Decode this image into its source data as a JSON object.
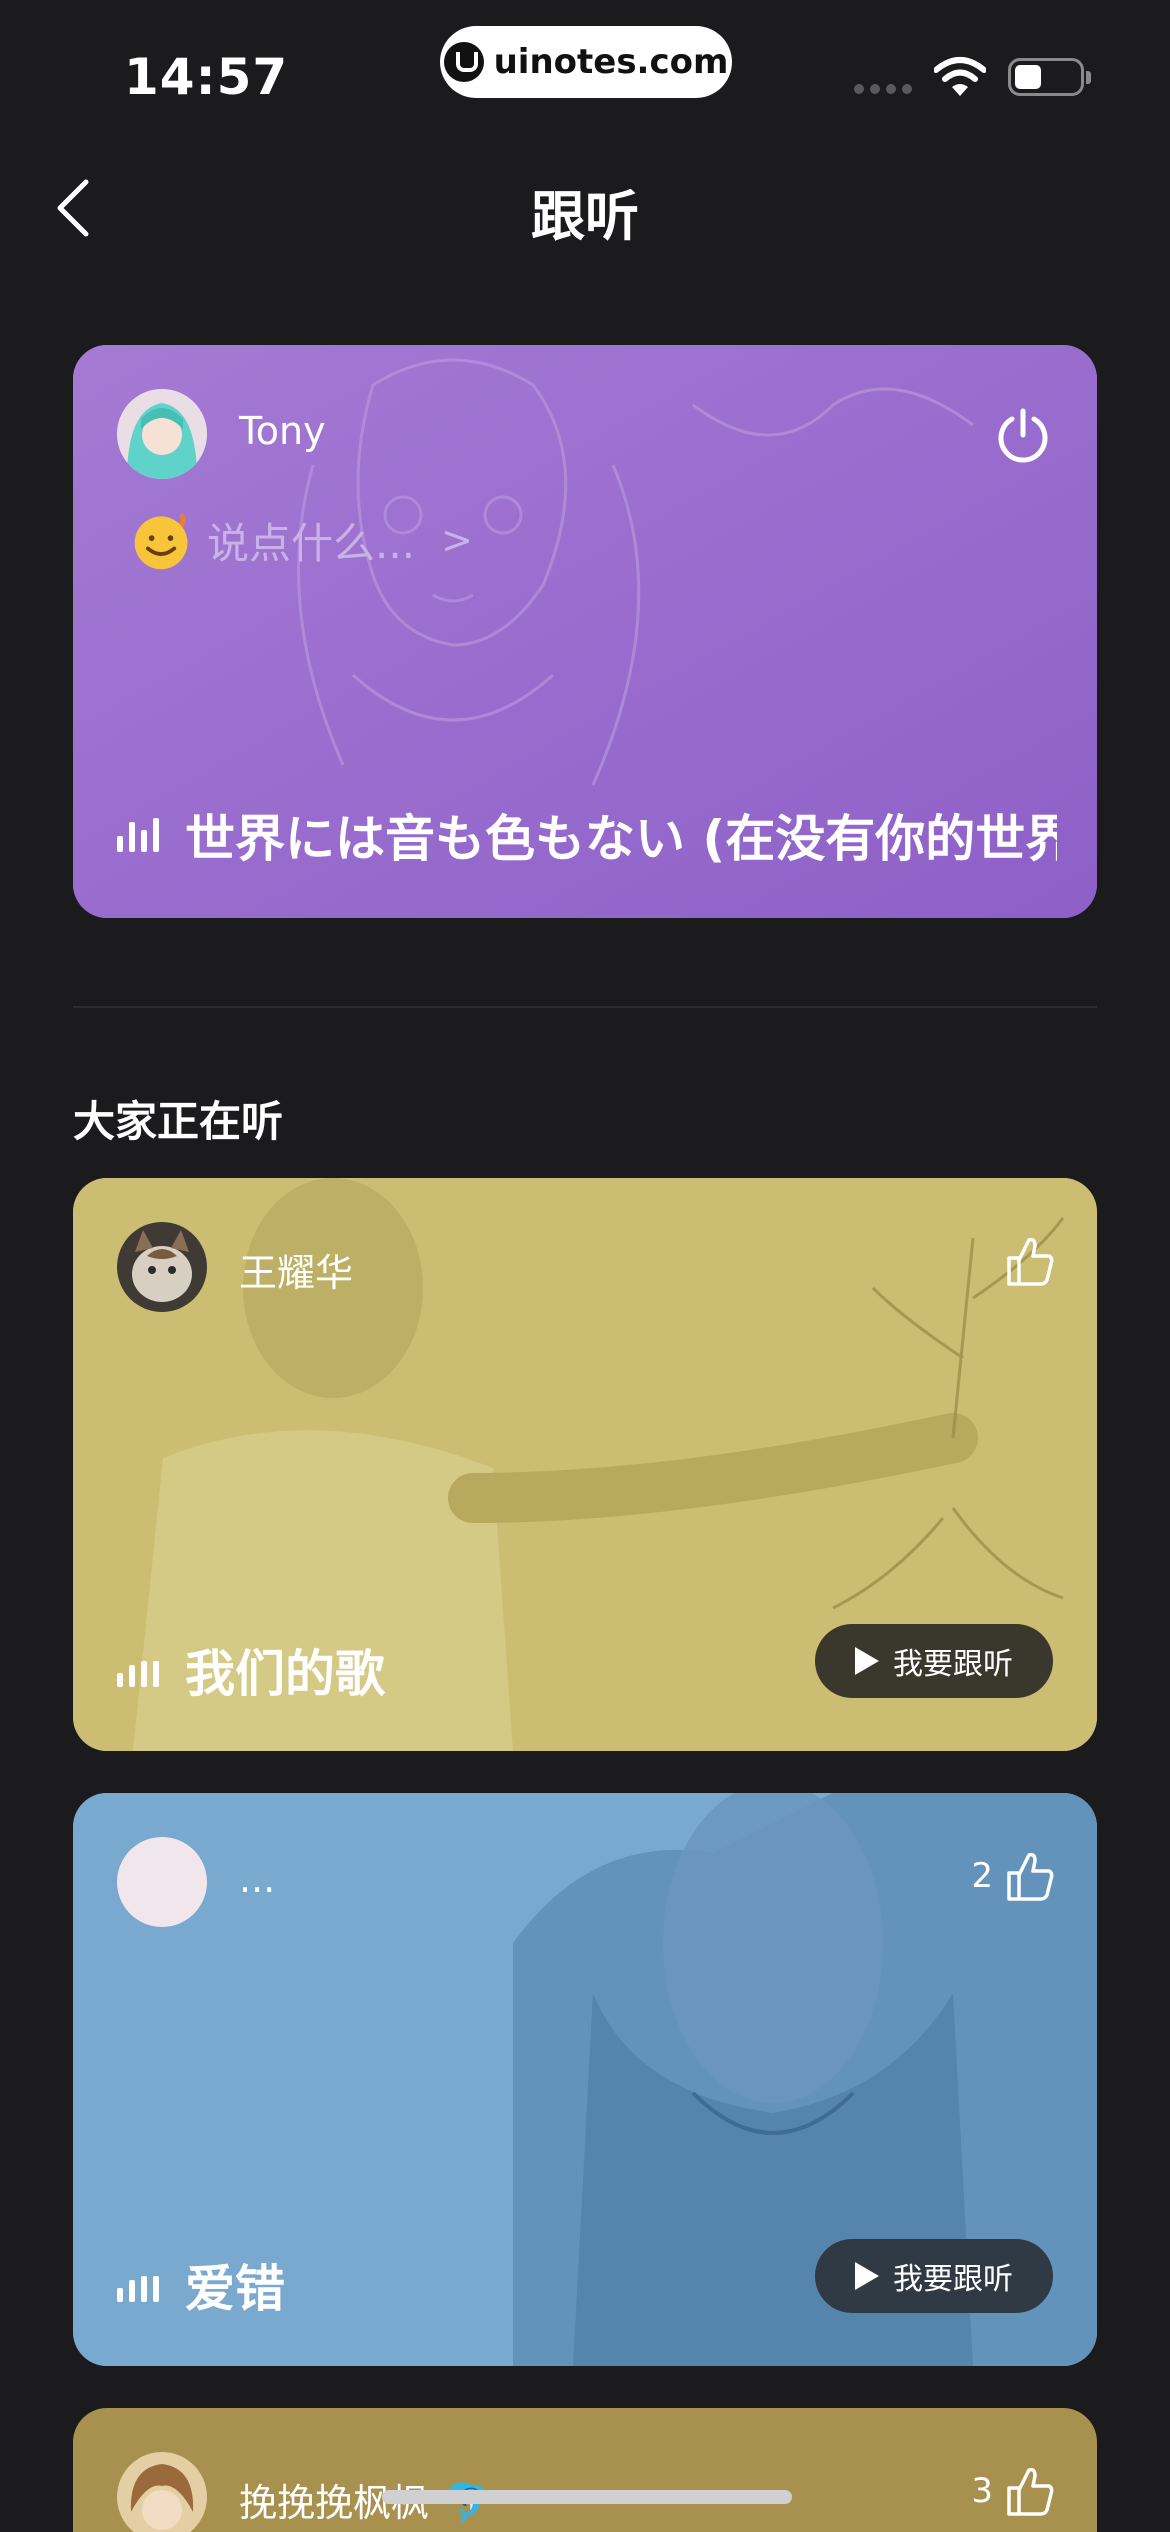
{
  "status_bar": {
    "time": "14:57",
    "watermark": "uinotes.com"
  },
  "nav": {
    "title": "跟听"
  },
  "my_card": {
    "username": "Tony",
    "prompt": "说点什么...",
    "prompt_chevron": ">",
    "song": "世界には音も色もない (在没有你的世界!",
    "color": "#9a6fd0"
  },
  "section": {
    "title": "大家正在听"
  },
  "listeners": [
    {
      "username": "王耀华",
      "song": "我们的歌",
      "follow_label": "我要跟听",
      "likes": "",
      "color": "#cbbd72"
    },
    {
      "username": "...",
      "song": "爱错",
      "follow_label": "我要跟听",
      "likes": "2",
      "color": "#79a9cf"
    },
    {
      "username": "挽挽挽枫枫 🐬",
      "song": "",
      "follow_label": "",
      "likes": "3",
      "color": "#a8904e"
    }
  ],
  "icons": [
    "back-icon",
    "power-icon",
    "smiley-icon",
    "equalizer-icon",
    "thumbs-up-icon",
    "play-icon"
  ]
}
